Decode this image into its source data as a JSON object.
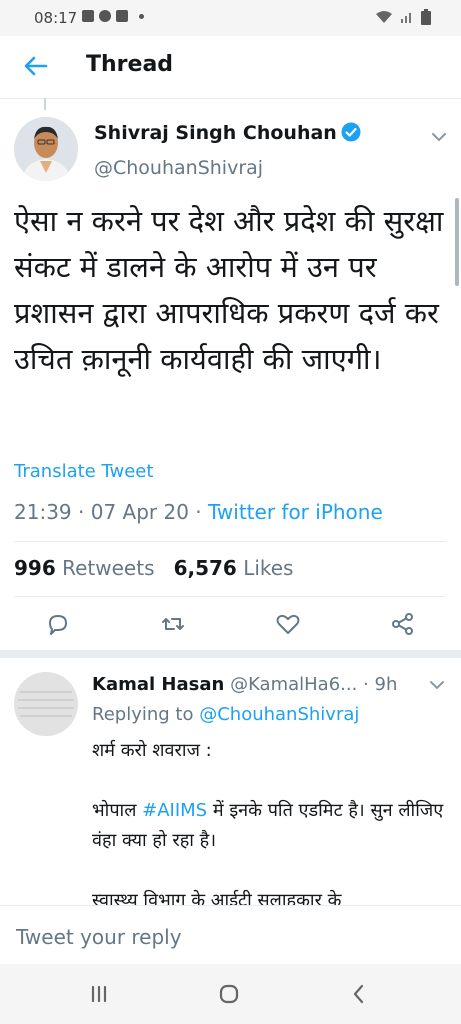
{
  "status_bar": {
    "time": "08:17"
  },
  "header": {
    "title": "Thread"
  },
  "tweet": {
    "author_name": "Shivraj Singh Chouhan",
    "author_handle": "@ChouhanShivraj",
    "text": "ऐसा न करने पर देश और प्रदेश की सुरक्षा संकट में डालने के आरोप में उन पर प्रशासन द्वारा आपराधिक प्रकरण दर्ज कर उचित क़ानूनी कार्यवाही की जाएगी।",
    "translate_label": "Translate Tweet",
    "time": "21:39",
    "date": "07 Apr 20",
    "source": "Twitter for iPhone",
    "retweets_count": "996",
    "retweets_label": "Retweets",
    "likes_count": "6,576",
    "likes_label": "Likes"
  },
  "reply": {
    "author_name": "Kamal Hasan",
    "author_handle": "@KamalHa6...",
    "time": "9h",
    "replying_prefix": "Replying to",
    "replying_to": "@ChouhanShivraj",
    "line1": "शर्म करो शवराज :",
    "line2_pre": "भोपाल ",
    "line2_tag": "#AIIMS",
    "line2_post": " में इनके पति एडमिट है। सुन लीजिए वंहा क्या हो रहा है।",
    "line3": "स्वास्थ्य विभाग के आईटी सलाहकार के"
  },
  "compose": {
    "placeholder": "Tweet your reply"
  },
  "colors": {
    "accent": "#1da1f2",
    "secondary_text": "#657786"
  }
}
